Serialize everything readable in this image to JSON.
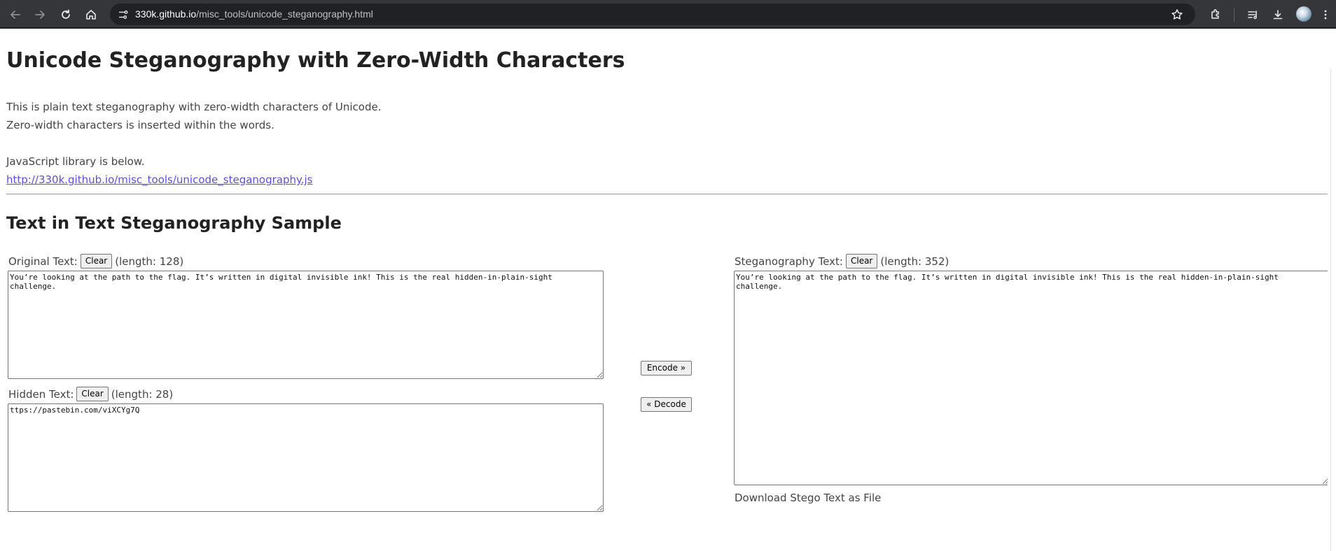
{
  "browser": {
    "url_host": "330k.github.io",
    "url_path": "/misc_tools/unicode_steganography.html",
    "icons": [
      "back-arrow-icon",
      "forward-arrow-icon",
      "reload-icon",
      "home-icon",
      "site-info-icon",
      "bookmark-star-icon",
      "extensions-icon",
      "reading-list-icon",
      "download-icon",
      "profile-avatar",
      "menu-kebab-icon"
    ]
  },
  "page": {
    "title": "Unicode Steganography with Zero-Width Characters",
    "intro_line_1": "This is plain text steganography with zero-width characters of Unicode.",
    "intro_line_2": "Zero-width characters is inserted within the words.",
    "library_label": "JavaScript library is below.",
    "library_link": "http://330k.github.io/misc_tools/unicode_steganography.js",
    "section_title": "Text in Text Steganography Sample"
  },
  "original": {
    "label": "Original Text:",
    "clear_label": "Clear",
    "length_text": "(length: 128)",
    "value": "You’re looking at the path to the flag. It’s written in digital invisible ink! This is the real hidden-in-plain-sight challenge."
  },
  "hidden": {
    "label": "Hidden Text:",
    "clear_label": "Clear",
    "length_text": "(length: 28)",
    "value": "ttps://pastebin.com/viXCYg7Q"
  },
  "actions": {
    "encode_label": "Encode »",
    "decode_label": "« Decode"
  },
  "stego": {
    "label": "Steganography Text:",
    "clear_label": "Clear",
    "length_text": "(length: 352)",
    "value": "You’re looking at the path to the flag. It’s written in digital invisible ink! This is the real hidden-in-plain-sight challenge.",
    "download_label": "Download Stego Text as File"
  },
  "colors": {
    "chrome_bg": "#35363a",
    "omnibox_bg": "#202124",
    "link": "#5b4fd6"
  }
}
